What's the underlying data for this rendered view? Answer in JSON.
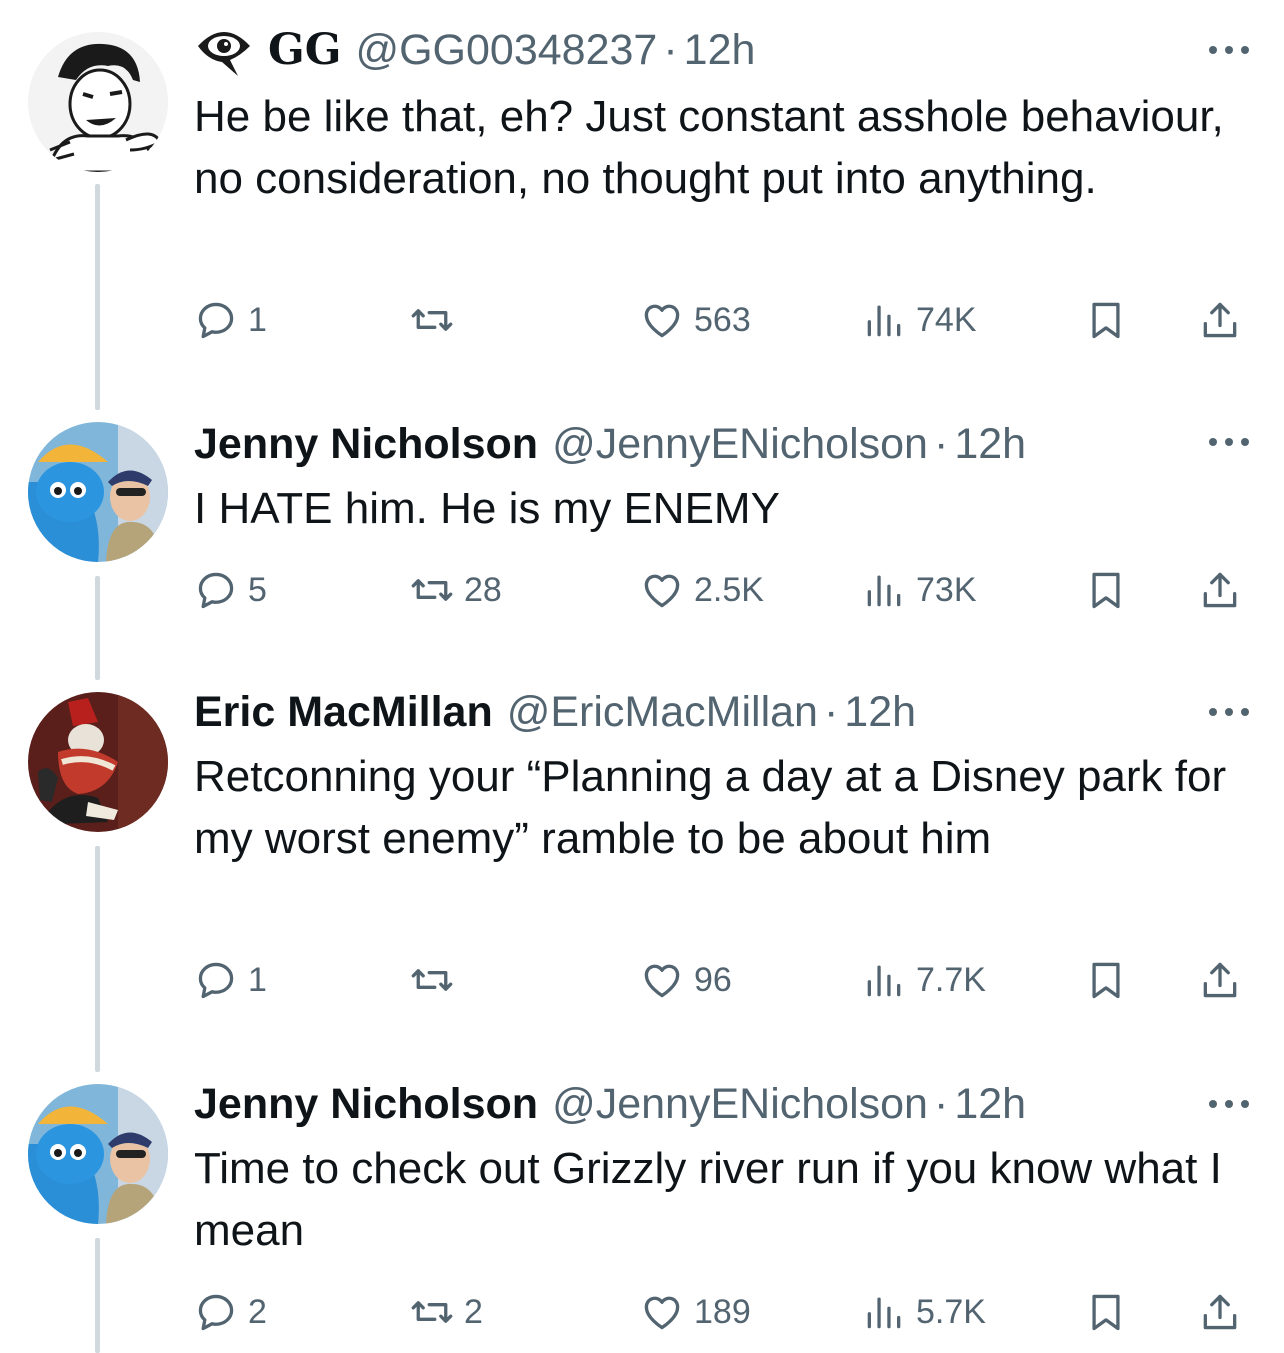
{
  "tweets": [
    {
      "name": "GG",
      "handle": "@GG00348237",
      "dot": "·",
      "time": "12h",
      "text": "He be like that, eh? Just constant asshole behaviour, no consideration, no thought put into anything.",
      "reply_count": "1",
      "repost_count": "",
      "like_count": "563",
      "view_count": "74K",
      "avatar_icon": "sketch-avatar-icon",
      "badge_icon": "eye-badge-icon"
    },
    {
      "name": "Jenny Nicholson",
      "handle": "@JennyENicholson",
      "dot": "·",
      "time": "12h",
      "text": "I HATE him. He is my ENEMY",
      "reply_count": "5",
      "repost_count": "28",
      "like_count": "2.5K",
      "view_count": "73K",
      "avatar_icon": "photo-avatar-icon"
    },
    {
      "name": "Eric MacMillan",
      "handle": "@EricMacMillan",
      "dot": "·",
      "time": "12h",
      "text": "Retconning your “Planning a day at a Disney park for my worst enemy” ramble to be about him",
      "reply_count": "1",
      "repost_count": "",
      "like_count": "96",
      "view_count": "7.7K",
      "avatar_icon": "painting-avatar-icon"
    },
    {
      "name": "Jenny Nicholson",
      "handle": "@JennyENicholson",
      "dot": "·",
      "time": "12h",
      "text": "Time to check out Grizzly river run if you know what I mean",
      "reply_count": "2",
      "repost_count": "2",
      "like_count": "189",
      "view_count": "5.7K",
      "avatar_icon": "photo-avatar-icon"
    }
  ],
  "colors": {
    "text": "#0f1419",
    "secondary": "#536471",
    "thread_line": "#cfd9de",
    "background": "#ffffff"
  }
}
